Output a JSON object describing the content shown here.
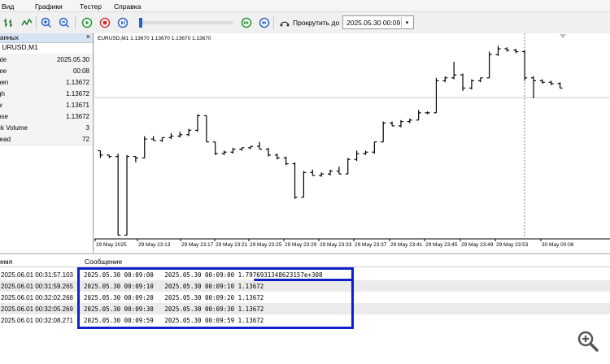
{
  "menu": [
    "Вид",
    "Графики",
    "Тестер",
    "Справка"
  ],
  "toolbar": {
    "scroll_label": "Прокрутить до",
    "datetime_value": "2025.05.30 00:09"
  },
  "data_window": {
    "title": "анных",
    "symbol": "URUSD,M1",
    "rows": [
      {
        "key": "ate",
        "value": "2025.05.30"
      },
      {
        "key": "me",
        "value": "00:08"
      },
      {
        "key": "pen",
        "value": "1.13672"
      },
      {
        "key": "gh",
        "value": "1.13672"
      },
      {
        "key": "w",
        "value": "1.13671"
      },
      {
        "key": "ose",
        "value": "1.13672"
      },
      {
        "key": "ck Volume",
        "value": "3"
      },
      {
        "key": "read",
        "value": "72"
      }
    ]
  },
  "chart": {
    "title": "EURUSD,M1  1.13670 1.13670 1.13670 1.13670",
    "xticks": [
      "29 May 2025",
      "29 May 23:13",
      "29 May 23:17",
      "29 May 23:21",
      "29 May 23:25",
      "29 May 23:29",
      "29 May 23:33",
      "29 May 23:37",
      "29 May 23:41",
      "29 May 23:45",
      "29 May 23:49",
      "29 May 23:53",
      "30 May 00:08"
    ]
  },
  "chart_data": {
    "type": "bar",
    "title": "EURUSD,M1  1.13670 1.13670 1.13670 1.13670",
    "categories": [
      "29 May 2025",
      "29 May 23:13",
      "29 May 23:17",
      "29 May 23:21",
      "29 May 23:25",
      "29 May 23:29",
      "29 May 23:33",
      "29 May 23:37",
      "29 May 23:41",
      "29 May 23:45",
      "29 May 23:49",
      "29 May 23:53",
      "30 May 00:08"
    ],
    "bars": [
      {
        "o": 60,
        "h": 60,
        "l": 55,
        "c": 57
      },
      {
        "o": 57,
        "h": 57,
        "l": 55,
        "c": 56
      },
      {
        "o": 56,
        "h": 58,
        "l": 2,
        "c": 2
      },
      {
        "o": 2,
        "h": 57,
        "l": 2,
        "c": 56
      },
      {
        "o": 56,
        "h": 56,
        "l": 52,
        "c": 55
      },
      {
        "o": 55,
        "h": 70,
        "l": 55,
        "c": 68
      },
      {
        "o": 68,
        "h": 70,
        "l": 67,
        "c": 67
      },
      {
        "o": 67,
        "h": 69,
        "l": 66,
        "c": 69
      },
      {
        "o": 69,
        "h": 72,
        "l": 68,
        "c": 70
      },
      {
        "o": 70,
        "h": 73,
        "l": 69,
        "c": 71
      },
      {
        "o": 71,
        "h": 75,
        "l": 70,
        "c": 74
      },
      {
        "o": 74,
        "h": 85,
        "l": 73,
        "c": 84
      },
      {
        "o": 84,
        "h": 84,
        "l": 66,
        "c": 66
      },
      {
        "o": 66,
        "h": 66,
        "l": 57,
        "c": 58
      },
      {
        "o": 58,
        "h": 60,
        "l": 57,
        "c": 59
      },
      {
        "o": 59,
        "h": 62,
        "l": 58,
        "c": 61
      },
      {
        "o": 61,
        "h": 62,
        "l": 60,
        "c": 62
      },
      {
        "o": 62,
        "h": 63,
        "l": 61,
        "c": 63
      },
      {
        "o": 63,
        "h": 66,
        "l": 61,
        "c": 61
      },
      {
        "o": 61,
        "h": 62,
        "l": 56,
        "c": 57
      },
      {
        "o": 57,
        "h": 58,
        "l": 54,
        "c": 55
      },
      {
        "o": 55,
        "h": 56,
        "l": 50,
        "c": 51
      },
      {
        "o": 51,
        "h": 52,
        "l": 27,
        "c": 28
      },
      {
        "o": 28,
        "h": 46,
        "l": 28,
        "c": 45
      },
      {
        "o": 45,
        "h": 47,
        "l": 43,
        "c": 43
      },
      {
        "o": 43,
        "h": 45,
        "l": 42,
        "c": 44
      },
      {
        "o": 44,
        "h": 47,
        "l": 43,
        "c": 46
      },
      {
        "o": 46,
        "h": 49,
        "l": 44,
        "c": 44
      },
      {
        "o": 44,
        "h": 55,
        "l": 44,
        "c": 54
      },
      {
        "o": 54,
        "h": 60,
        "l": 53,
        "c": 58
      },
      {
        "o": 58,
        "h": 60,
        "l": 57,
        "c": 59
      },
      {
        "o": 59,
        "h": 66,
        "l": 58,
        "c": 66
      },
      {
        "o": 66,
        "h": 80,
        "l": 66,
        "c": 79
      },
      {
        "o": 79,
        "h": 80,
        "l": 77,
        "c": 77
      },
      {
        "o": 77,
        "h": 81,
        "l": 76,
        "c": 80
      },
      {
        "o": 80,
        "h": 82,
        "l": 79,
        "c": 81
      },
      {
        "o": 81,
        "h": 88,
        "l": 81,
        "c": 86
      },
      {
        "o": 86,
        "h": 87,
        "l": 85,
        "c": 86
      },
      {
        "o": 86,
        "h": 110,
        "l": 86,
        "c": 108
      },
      {
        "o": 108,
        "h": 111,
        "l": 107,
        "c": 110
      },
      {
        "o": 110,
        "h": 121,
        "l": 109,
        "c": 112
      },
      {
        "o": 112,
        "h": 113,
        "l": 101,
        "c": 103
      },
      {
        "o": 103,
        "h": 109,
        "l": 102,
        "c": 108
      },
      {
        "o": 108,
        "h": 110,
        "l": 107,
        "c": 110
      },
      {
        "o": 110,
        "h": 128,
        "l": 110,
        "c": 126
      },
      {
        "o": 126,
        "h": 132,
        "l": 125,
        "c": 130
      },
      {
        "o": 130,
        "h": 131,
        "l": 128,
        "c": 129
      },
      {
        "o": 129,
        "h": 130,
        "l": 127,
        "c": 128
      },
      {
        "o": 128,
        "h": 129,
        "l": 108,
        "c": 110
      },
      {
        "o": 110,
        "h": 111,
        "l": 96,
        "c": 108
      },
      {
        "o": 108,
        "h": 109,
        "l": 106,
        "c": 107
      },
      {
        "o": 107,
        "h": 108,
        "l": 105,
        "c": 106
      },
      {
        "o": 106,
        "h": 107,
        "l": 103,
        "c": 103
      }
    ],
    "ylim": [
      0,
      135
    ]
  },
  "journal": {
    "col_time": "емя",
    "col_message": "Сообщение",
    "rows": [
      {
        "time": "2025.06.01 00:31:57.103",
        "message": "2025.05.30 00:09:00   2025.05.30 00:09:00 1.7976931348623157e+308"
      },
      {
        "time": "2025.06.01 00:31:59.265",
        "message": "2025.05.30 00:09:10   2025.05.30 00:09:10 1.13672"
      },
      {
        "time": "2025.06.01 00:32:02.268",
        "message": "2025.05.30 00:09:20   2025.05.30 00:09:20 1.13672"
      },
      {
        "time": "2025.06.01 00:32:05.269",
        "message": "2025.05.30 00:09:30   2025.05.30 00:09:30 1.13672"
      },
      {
        "time": "2025.06.01 00:32:08.271",
        "message": "2025.05.30 00:09:59   2025.05.30 00:09:59 1.13672"
      }
    ]
  },
  "colors": {
    "highlight": "#1020c8",
    "panel_header": "#d7e4f2"
  }
}
